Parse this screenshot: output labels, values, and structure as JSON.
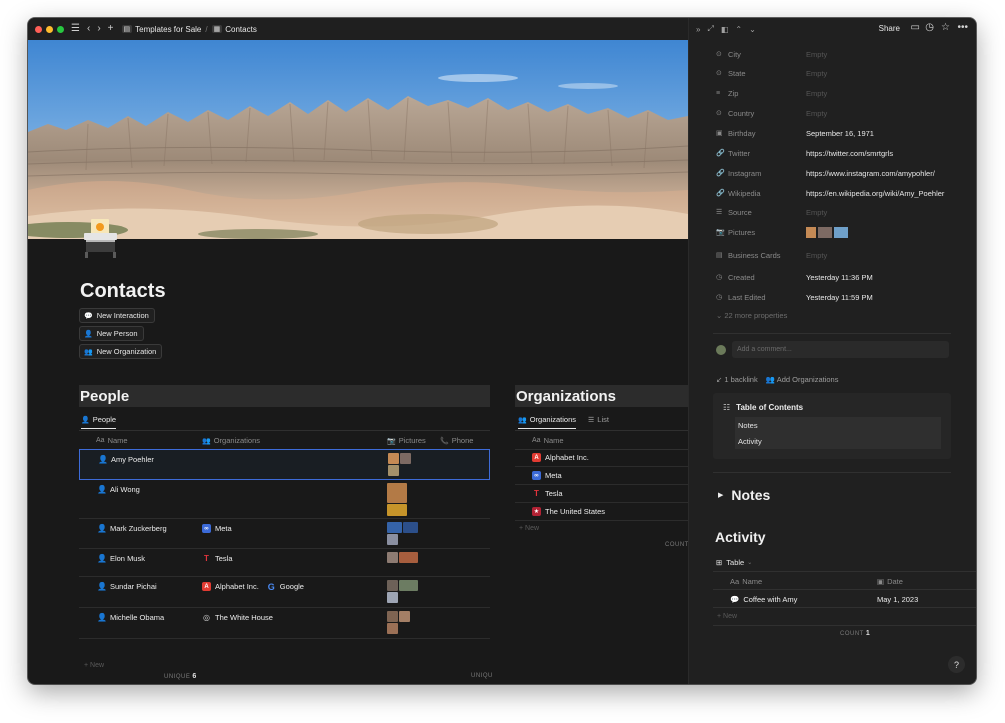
{
  "topbar": {
    "breadcrumb": [
      {
        "icon": "template-icon",
        "label": "Templates for Sale"
      },
      {
        "icon": "contacts-icon",
        "label": "Contacts"
      }
    ]
  },
  "page": {
    "title": "Contacts",
    "buttons": [
      {
        "label": "New Interaction",
        "icon": "interaction-icon"
      },
      {
        "label": "New Person",
        "icon": "person-icon"
      },
      {
        "label": "New Organization",
        "icon": "organization-icon"
      }
    ]
  },
  "people": {
    "heading": "People",
    "view_tab": "People",
    "columns": {
      "name": "Name",
      "organizations": "Organizations",
      "pictures": "Pictures",
      "phone": "Phone"
    },
    "rows": [
      {
        "name": "Amy Poehler",
        "orgs": []
      },
      {
        "name": "Ali Wong",
        "orgs": []
      },
      {
        "name": "Mark Zuckerberg",
        "orgs": [
          {
            "name": "Meta",
            "logo": "meta-logo"
          }
        ]
      },
      {
        "name": "Elon Musk",
        "orgs": [
          {
            "name": "Tesla",
            "logo": "tesla-logo"
          }
        ]
      },
      {
        "name": "Sundar Pichai",
        "orgs": [
          {
            "name": "Alphabet Inc.",
            "logo": "alphabet-logo"
          },
          {
            "name": "Google",
            "logo": "google-logo"
          }
        ]
      },
      {
        "name": "Michelle Obama",
        "orgs": [
          {
            "name": "The White House",
            "logo": "white-house-logo"
          }
        ]
      }
    ],
    "new_label": "New",
    "unique_label": "UNIQUE",
    "unique_value": "6",
    "unique_right_label": "UNIQU"
  },
  "organizations": {
    "heading": "Organizations",
    "view_tabs": [
      "Organizations",
      "List"
    ],
    "column": "Name",
    "rows": [
      {
        "name": "Alphabet Inc.",
        "expandable": true
      },
      {
        "name": "Meta",
        "expandable": false
      },
      {
        "name": "Tesla",
        "expandable": false
      },
      {
        "name": "The United States",
        "expandable": true
      }
    ],
    "new_label": "New",
    "count_label": "COUNT"
  },
  "panel": {
    "share_label": "Share",
    "properties": [
      {
        "icon": "select-icon",
        "key": "City",
        "value": "Empty",
        "empty": true
      },
      {
        "icon": "select-icon",
        "key": "State",
        "value": "Empty",
        "empty": true
      },
      {
        "icon": "text-icon",
        "key": "Zip",
        "value": "Empty",
        "empty": true
      },
      {
        "icon": "select-icon",
        "key": "Country",
        "value": "Empty",
        "empty": true
      },
      {
        "icon": "calendar-icon",
        "key": "Birthday",
        "value": "September 16, 1971",
        "empty": false
      },
      {
        "icon": "link-icon",
        "key": "Twitter",
        "value": "https://twitter.com/smrtgrls",
        "empty": false
      },
      {
        "icon": "link-icon",
        "key": "Instagram",
        "value": "https://www.instagram.com/amypohler/",
        "empty": false
      },
      {
        "icon": "link-icon",
        "key": "Wikipedia",
        "value": "https://en.wikipedia.org/wiki/Amy_Poehler",
        "empty": false
      },
      {
        "icon": "list-icon",
        "key": "Source",
        "value": "Empty",
        "empty": true
      },
      {
        "icon": "camera-icon",
        "key": "Pictures",
        "value": "",
        "empty": false
      },
      {
        "icon": "card-icon",
        "key": "Business Cards",
        "value": "Empty",
        "empty": true
      },
      {
        "icon": "clock-icon",
        "key": "Created",
        "value": "Yesterday 11:36 PM",
        "empty": false
      },
      {
        "icon": "clock-icon",
        "key": "Last Edited",
        "value": "Yesterday 11:59 PM",
        "empty": false
      }
    ],
    "more_properties": "22 more properties",
    "comment_placeholder": "Add a comment...",
    "backlink_label": "1 backlink",
    "backlink_target": "Add Organizations",
    "toc": {
      "title": "Table of Contents",
      "items": [
        "Notes",
        "Activity"
      ]
    },
    "notes_heading": "Notes",
    "activity": {
      "heading": "Activity",
      "view_label": "Table",
      "columns": {
        "name": "Name",
        "date": "Date"
      },
      "rows": [
        {
          "name": "Coffee with Amy",
          "date": "May 1, 2023"
        }
      ],
      "new_label": "New",
      "count_label": "COUNT",
      "count_value": "1"
    },
    "help_label": "?"
  },
  "colors": {
    "background": "#191919",
    "panel": "#202020",
    "accent_blue": "#2383e2",
    "text": "#e6e6e6",
    "muted": "#8a8a8a"
  }
}
